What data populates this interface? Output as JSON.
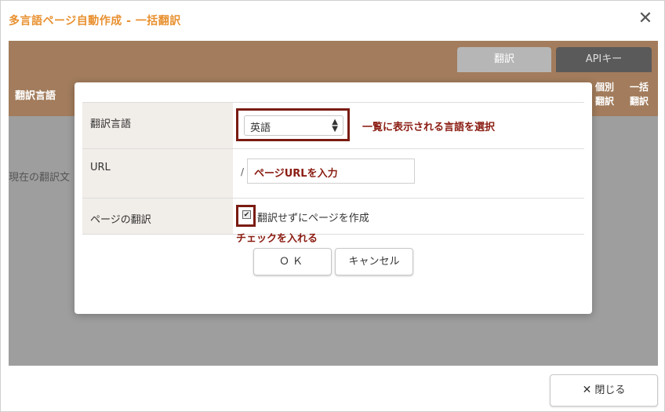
{
  "window": {
    "title": "多言語ページ自動作成 - 一括翻訳",
    "close_glyph": "✕"
  },
  "background": {
    "tabs": [
      "翻訳",
      "APIキー"
    ],
    "column_header": "翻訳言語",
    "right_headers": [
      "個別\n翻訳",
      "一括\n翻訳"
    ],
    "right_headers_lines": [
      [
        "個別",
        "翻訳"
      ],
      [
        "一括",
        "翻訳"
      ]
    ],
    "body_text": "現在の翻訳文"
  },
  "modal": {
    "rows": [
      {
        "label": "翻訳言語"
      },
      {
        "label": "URL"
      },
      {
        "label": "ページの翻訳"
      }
    ],
    "language_select": {
      "value": "英語"
    },
    "language_note": "一覧に表示される言語を選択",
    "url_slash": "/",
    "url_input": {
      "value": "ページURLを入力"
    },
    "checkbox": {
      "checked": true,
      "label": "翻訳せずにページを作成"
    },
    "checkbox_note": "チェックを入れる",
    "ok_label": "ＯＫ",
    "cancel_label": "キャンセル"
  },
  "footer": {
    "close_label": "閉じる",
    "close_glyph": "✕"
  },
  "colors": {
    "title": "#e8902f",
    "header_bar": "#a27c5c",
    "annotation": "#8a1c12"
  }
}
